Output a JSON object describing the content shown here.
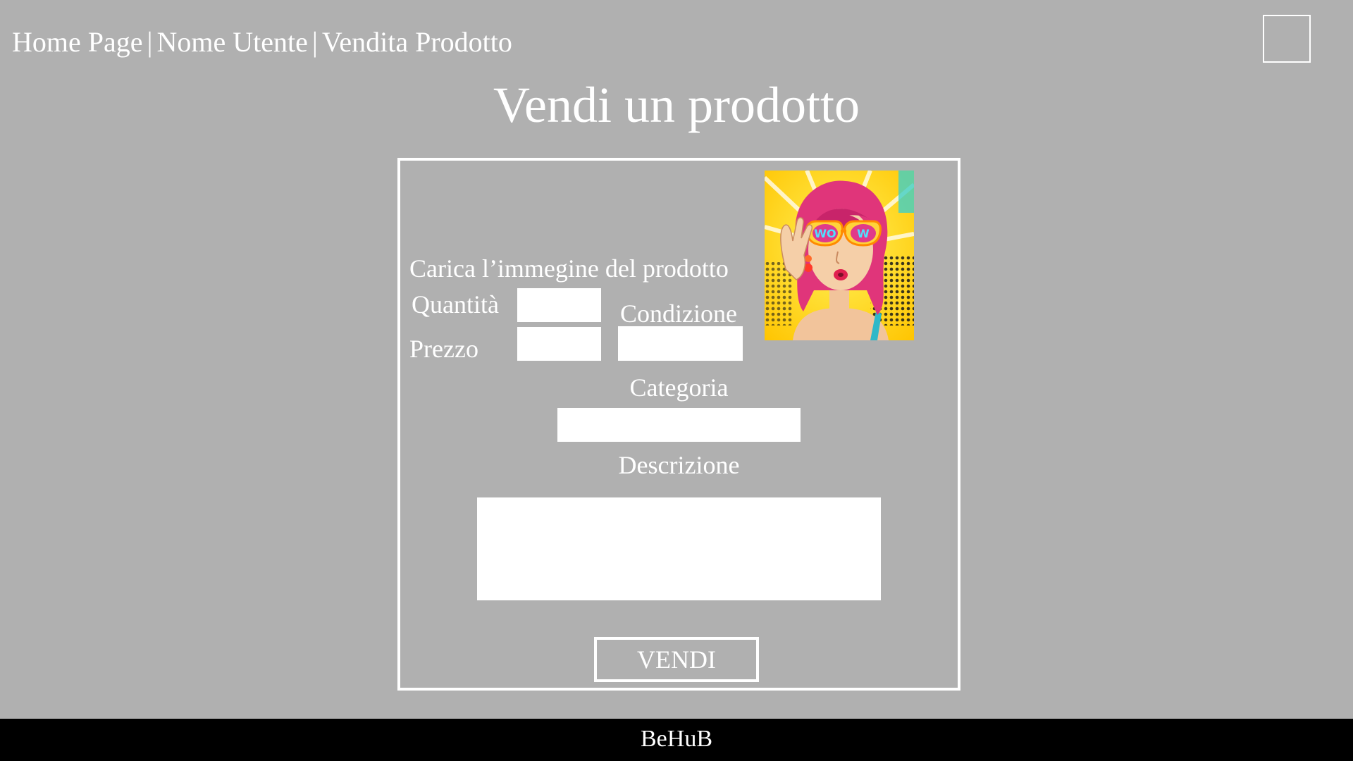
{
  "nav": {
    "home": "Home Page",
    "separator": "|",
    "user": "Nome Utente",
    "current": "Vendita Prodotto"
  },
  "page": {
    "title": "Vendi un prodotto"
  },
  "form": {
    "upload_label": "Carica l’immegine del prodotto",
    "quantity_label": "Quantità",
    "quantity_value": "",
    "price_label": "Prezzo",
    "price_value": "",
    "condition_label": "Condizione",
    "condition_value": "",
    "category_label": "Categoria",
    "category_value": "",
    "description_label": "Descrizione",
    "description_value": "",
    "submit_label": "VENDI"
  },
  "image": {
    "description": "pop-art-woman-sunglasses",
    "lettering": "WOW"
  },
  "footer": {
    "brand": "BeHuB"
  },
  "colors": {
    "background": "#b0b0b0",
    "text": "#ffffff",
    "field": "#ffffff",
    "footer": "#000000"
  }
}
